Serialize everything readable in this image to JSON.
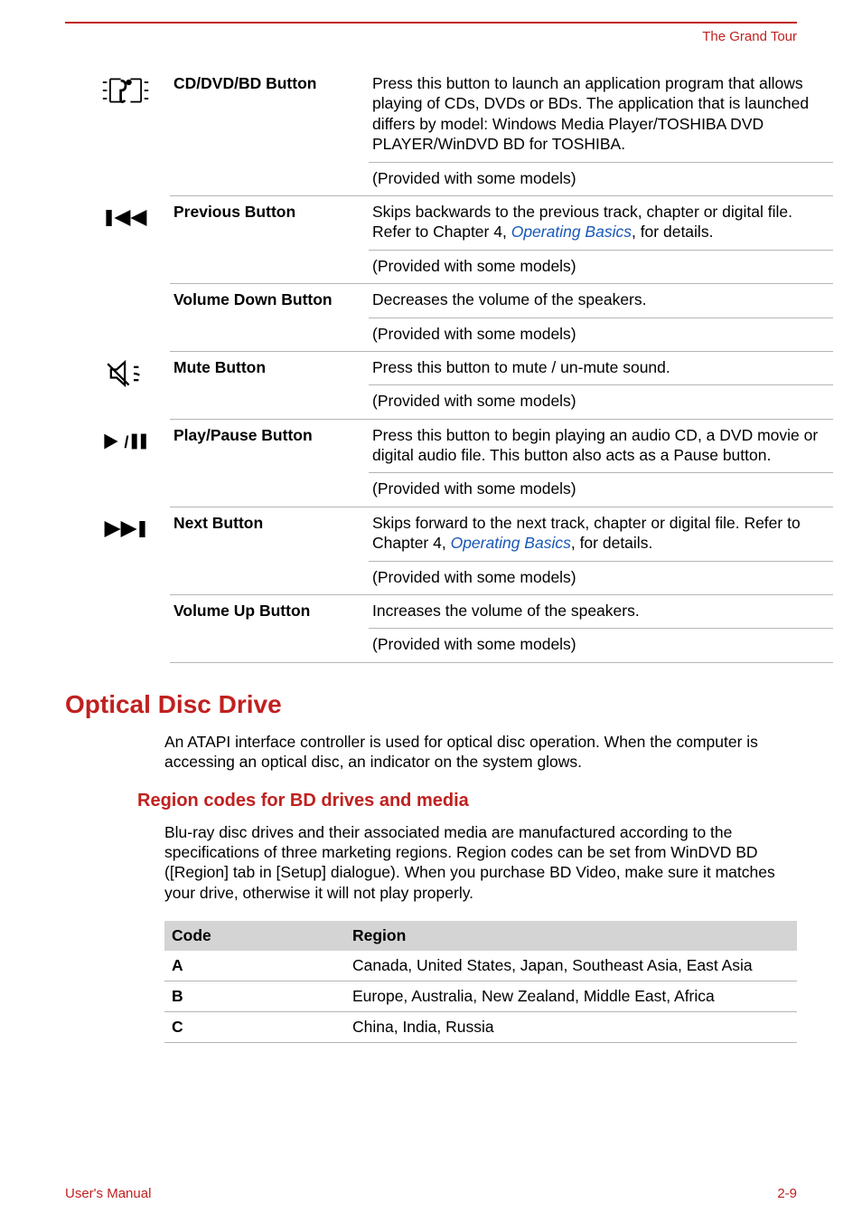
{
  "header": {
    "section": "The Grand Tour"
  },
  "footer": {
    "left": "User's Manual",
    "right": "2-9"
  },
  "buttons": [
    {
      "icon": "cd-dvd-bd-icon",
      "name": "CD/DVD/BD Button",
      "desc": "Press this button to launch an application program that allows playing of CDs, DVDs or BDs. The application that is launched differs by model: Windows Media Player/TOSHIBA DVD PLAYER/WinDVD BD for TOSHIBA.",
      "note": "(Provided with some models)"
    },
    {
      "icon": "previous-icon",
      "name": "Previous Button",
      "desc_pre": "Skips backwards to the previous track, chapter or digital file. Refer to Chapter 4, ",
      "link": "Operating Basics",
      "desc_post": ", for details.",
      "note": "(Provided with some models)"
    },
    {
      "icon": "",
      "name": "Volume Down Button",
      "desc": "Decreases the volume of the speakers.",
      "note": "(Provided with some models)"
    },
    {
      "icon": "mute-icon",
      "name": "Mute Button",
      "desc": "Press this button to mute / un-mute sound.",
      "note": "(Provided with some models)"
    },
    {
      "icon": "play-pause-icon",
      "name": "Play/Pause Button",
      "desc": "Press this button to begin playing an audio CD, a DVD movie or digital audio file. This button also acts as a Pause button.",
      "note": "(Provided with some models)"
    },
    {
      "icon": "next-icon",
      "name": "Next Button",
      "desc_pre": "Skips forward to the next track, chapter or digital file. Refer to Chapter 4, ",
      "link": "Operating Basics",
      "desc_post": ", for details.",
      "note": "(Provided with some models)"
    },
    {
      "icon": "",
      "name": "Volume Up Button",
      "desc": "Increases the volume of the speakers.",
      "note": "(Provided with some models)"
    }
  ],
  "optical": {
    "heading": "Optical Disc Drive",
    "para": "An ATAPI interface controller is used for optical disc operation. When the computer is accessing an optical disc, an indicator on the system glows."
  },
  "region": {
    "heading": "Region codes for BD drives and media",
    "para": "Blu-ray disc drives and their associated media are manufactured according to the specifications of three marketing regions. Region codes can be set from WinDVD BD ([Region] tab in [Setup] dialogue). When you purchase BD Video, make sure it matches your drive, otherwise it will not play properly.",
    "headers": {
      "code": "Code",
      "region": "Region"
    },
    "rows": [
      {
        "code": "A",
        "region": "Canada, United States, Japan, Southeast Asia, East Asia"
      },
      {
        "code": "B",
        "region": "Europe, Australia, New Zealand, Middle East, Africa"
      },
      {
        "code": "C",
        "region": "China, India, Russia"
      }
    ]
  }
}
